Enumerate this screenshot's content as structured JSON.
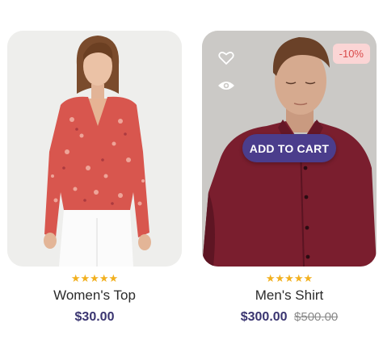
{
  "products": [
    {
      "name": "Women's Top",
      "price": "$30.00",
      "rating_stars": "★★★★★"
    },
    {
      "name": "Men's Shirt",
      "price": "$300.00",
      "old_price": "$500.00",
      "discount": "-10%",
      "rating_stars": "★★★★★",
      "cart_label": "ADD TO CART",
      "wishlist_icon": "heart-icon",
      "quickview_icon": "eye-icon"
    }
  ],
  "colors": {
    "accent": "#4b3d8c",
    "price": "#3a3571",
    "star": "#f2b01e",
    "badge_bg": "#fbd5d5",
    "badge_text": "#d94a4a"
  }
}
